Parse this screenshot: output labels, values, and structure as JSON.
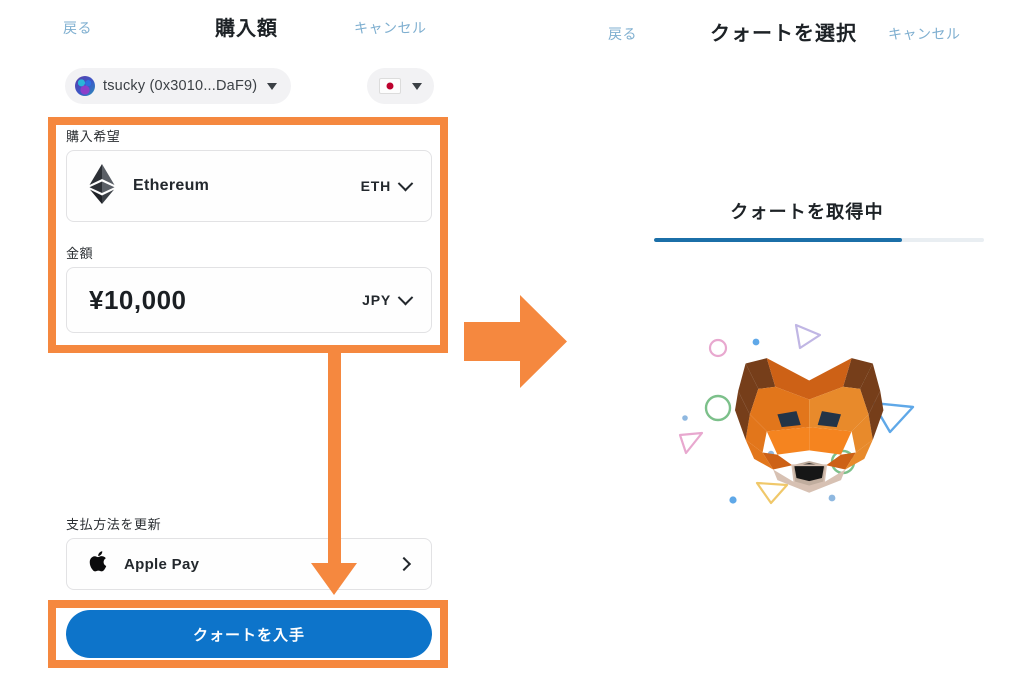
{
  "left_panel": {
    "nav": {
      "back_label": "戻る",
      "title": "購入額",
      "cancel_label": "キャンセル"
    },
    "account": {
      "name": "tsucky (0x3010...DaF9)",
      "avatar_icon": "jazzicon-avatar",
      "dropdown_icon": "caret-down-icon"
    },
    "currency_selector": {
      "flag_icon": "flag-jp-icon",
      "dropdown_icon": "caret-down-icon"
    },
    "asset_field": {
      "label": "購入希望",
      "icon": "ethereum-icon",
      "name": "Ethereum",
      "ticker": "ETH",
      "chevron_icon": "chevron-down-icon"
    },
    "amount_field": {
      "label": "金額",
      "value": "¥10,000",
      "ticker": "JPY",
      "chevron_icon": "chevron-down-icon"
    },
    "payment_method": {
      "label": "支払方法を更新",
      "icon": "apple-icon",
      "name": "Apple Pay",
      "chevron_icon": "chevron-right-icon"
    },
    "cta": {
      "label": "クォートを入手"
    }
  },
  "right_panel": {
    "nav": {
      "back_label": "戻る",
      "title": "クォートを選択",
      "cancel_label": "キャンセル"
    },
    "loading": {
      "title": "クォートを取得中",
      "progress_percent": 75,
      "logo_icon": "metamask-fox-icon"
    }
  },
  "annotations": {
    "highlight_color": "#f5883f",
    "arrow_right_icon": "arrow-right-icon",
    "arrow_down_icon": "arrow-down-icon",
    "form_highlight_name": "purchase-form-highlight",
    "cta_highlight_name": "cta-highlight"
  },
  "colors": {
    "accent_orange": "#f5883f",
    "primary_blue": "#0d74ca",
    "link_blue": "#7fafd0",
    "progress_blue": "#1b6fa8"
  }
}
